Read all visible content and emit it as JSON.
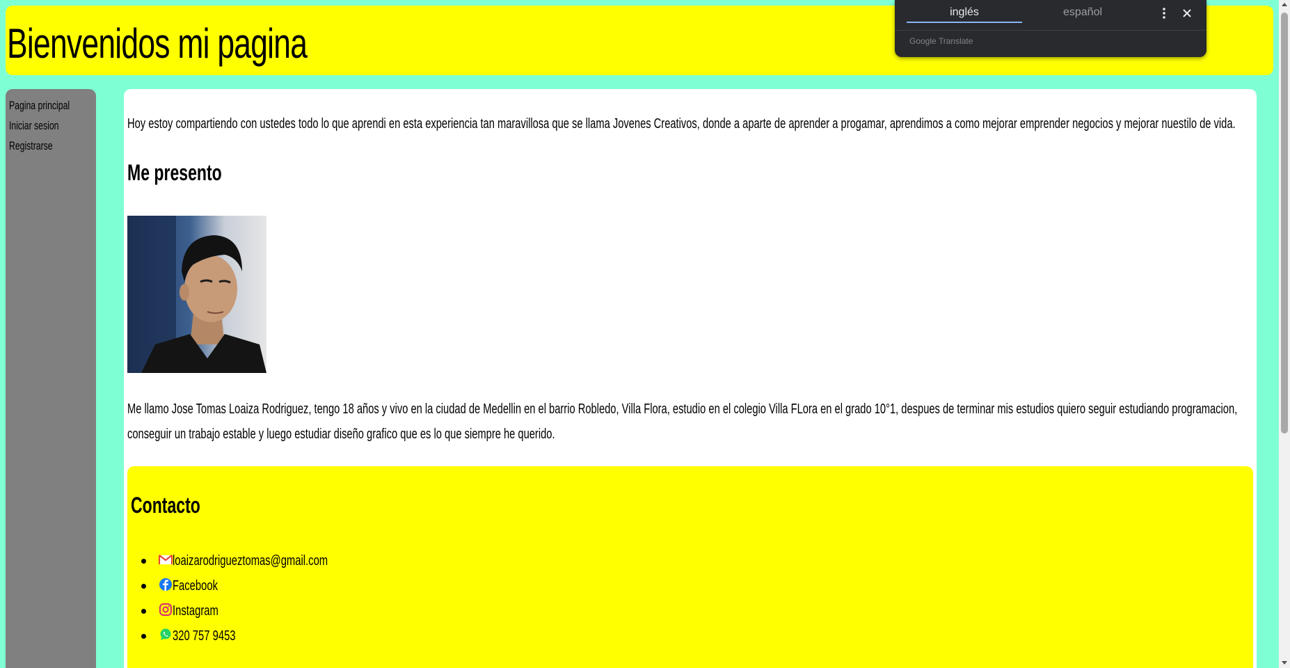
{
  "header": {
    "title": "Bienvenidos mi pagina"
  },
  "sidebar": {
    "links": [
      {
        "label": "Pagina principal"
      },
      {
        "label": "Iniciar sesion"
      },
      {
        "label": "Registrarse"
      }
    ]
  },
  "main": {
    "intro": "Hoy estoy compartiendo con ustedes todo lo que aprendi en esta experiencia tan maravillosa que se llama Jovenes Creativos, donde a aparte de aprender a progamar, aprendimos a como mejorar emprender negocios y mejorar nuestilo de vida.",
    "section_title": "Me presento",
    "bio_line1": "Me llamo Jose Tomas Loaiza Rodriguez, tengo 18 años y vivo en la ciudad de Medellin en el barrio Robledo, Villa Flora, estudio en el colegio Villa FLora en el grado 10°1, despues de terminar mis estudios quiero seguir estudiando programacion,",
    "bio_line2": "conseguir un trabajo estable y luego estudiar diseño grafico que es lo que siempre he querido.",
    "contact": {
      "title": "Contacto",
      "items": [
        {
          "icon": "gmail-icon",
          "label": "loaizarodrigueztomas@gmail.com"
        },
        {
          "icon": "facebook-icon",
          "label": "Facebook"
        },
        {
          "icon": "instagram-icon",
          "label": "Instagram"
        },
        {
          "icon": "whatsapp-icon",
          "label": "320 757 9453"
        }
      ]
    }
  },
  "translate_popup": {
    "tabs": [
      {
        "label": "inglés",
        "active": true
      },
      {
        "label": "español",
        "active": false
      }
    ],
    "brand": "Google Translate"
  },
  "colors": {
    "page_background": "#7fffd4",
    "header_background": "#ffff00",
    "sidebar_background": "#808080",
    "content_background": "#ffffff",
    "contact_background": "#ffff00"
  }
}
